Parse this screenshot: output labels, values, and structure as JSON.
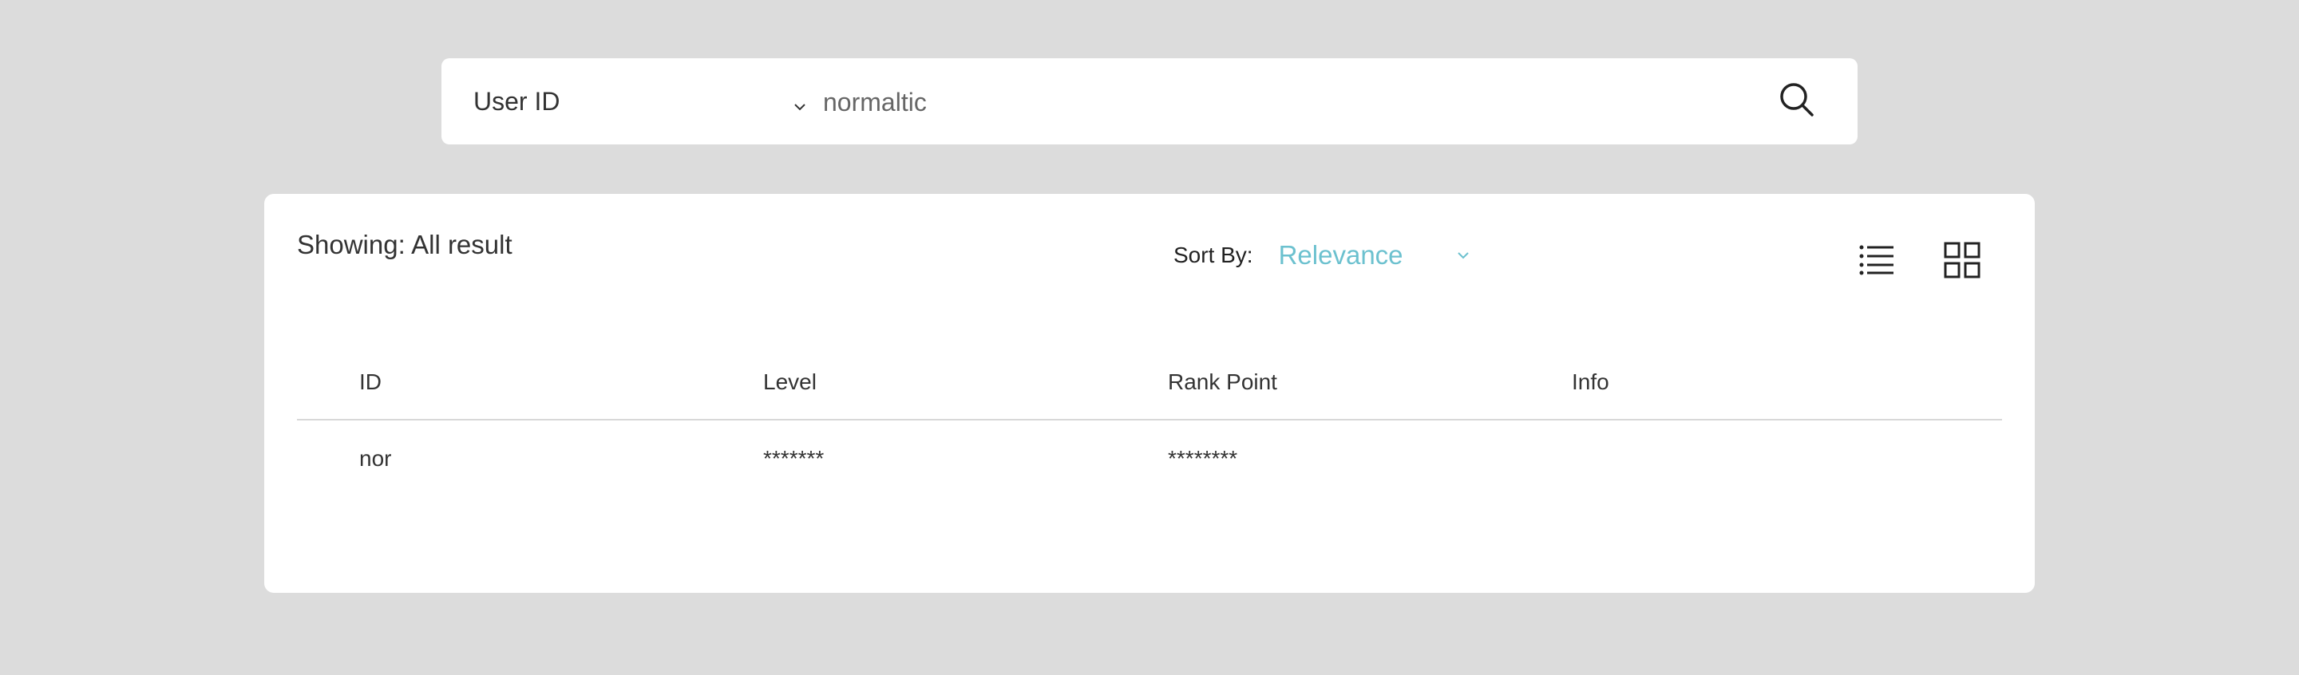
{
  "search": {
    "field_selected": "User ID",
    "query": "normaltic",
    "placeholder": ""
  },
  "results": {
    "showing_label": "Showing: All result",
    "sort_label": "Sort By:",
    "sort_value": "Relevance",
    "accent_color": "#6cc1cf"
  },
  "table": {
    "headers": [
      "ID",
      "Level",
      "Rank Point",
      "Info"
    ],
    "rows": [
      [
        "nor",
        "*******",
        "********",
        ""
      ]
    ]
  },
  "icons": {
    "search": "search-icon",
    "dropdown": "chevron-down-icon",
    "list_view": "list-view-icon",
    "grid_view": "grid-view-icon"
  }
}
